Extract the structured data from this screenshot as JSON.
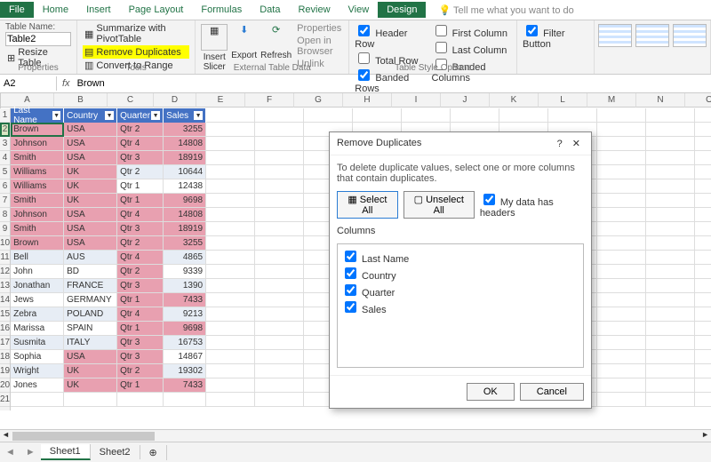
{
  "tabs": {
    "file": "File",
    "home": "Home",
    "insert": "Insert",
    "page_layout": "Page Layout",
    "formulas": "Formulas",
    "data": "Data",
    "review": "Review",
    "view": "View",
    "design": "Design",
    "tellme": "Tell me what you want to do"
  },
  "ribbon": {
    "tableName_label": "Table Name:",
    "tableName_value": "Table2",
    "resize": "Resize Table",
    "properties_group": "Properties",
    "summarize": "Summarize with PivotTable",
    "remove_dup": "Remove Duplicates",
    "convert": "Convert to Range",
    "tools_group": "Tools",
    "insert_slicer": "Insert Slicer",
    "export": "Export",
    "refresh": "Refresh",
    "props": "Properties",
    "open_browser": "Open in Browser",
    "unlink": "Unlink",
    "ext_group": "External Table Data",
    "header_row": "Header Row",
    "total_row": "Total Row",
    "banded_rows": "Banded Rows",
    "first_col": "First Column",
    "last_col": "Last Column",
    "banded_cols": "Banded Columns",
    "filter_btn": "Filter Button",
    "style_group": "Table Style Options"
  },
  "name_box": "A2",
  "fx": "fx",
  "formula": "Brown",
  "columns_letters": [
    "A",
    "B",
    "C",
    "D",
    "E",
    "F",
    "G",
    "H",
    "I",
    "J",
    "K",
    "L",
    "M",
    "N",
    "O"
  ],
  "headers": {
    "c1": "Last Name",
    "c2": "Country",
    "c3": "Quarter",
    "c4": "Sales"
  },
  "rows": [
    {
      "n": 2,
      "c1": "Brown",
      "c2": "USA",
      "c3": "Qtr 2",
      "c4": "3255",
      "dup": [
        1,
        1,
        1,
        1
      ]
    },
    {
      "n": 3,
      "c1": "Johnson",
      "c2": "USA",
      "c3": "Qtr 4",
      "c4": "14808",
      "dup": [
        1,
        1,
        1,
        1
      ]
    },
    {
      "n": 4,
      "c1": "Smith",
      "c2": "USA",
      "c3": "Qtr 3",
      "c4": "18919",
      "dup": [
        1,
        1,
        1,
        1
      ]
    },
    {
      "n": 5,
      "c1": "Williams",
      "c2": "UK",
      "c3": "Qtr 2",
      "c4": "10644",
      "dup": [
        1,
        1,
        0,
        0
      ]
    },
    {
      "n": 6,
      "c1": "Williams",
      "c2": "UK",
      "c3": "Qtr 1",
      "c4": "12438",
      "dup": [
        1,
        1,
        0,
        0
      ]
    },
    {
      "n": 7,
      "c1": "Smith",
      "c2": "UK",
      "c3": "Qtr 1",
      "c4": "9698",
      "dup": [
        1,
        1,
        1,
        1
      ]
    },
    {
      "n": 8,
      "c1": "Johnson",
      "c2": "USA",
      "c3": "Qtr 4",
      "c4": "14808",
      "dup": [
        1,
        1,
        1,
        1
      ]
    },
    {
      "n": 9,
      "c1": "Smith",
      "c2": "USA",
      "c3": "Qtr 3",
      "c4": "18919",
      "dup": [
        1,
        1,
        1,
        1
      ]
    },
    {
      "n": 10,
      "c1": "Brown",
      "c2": "USA",
      "c3": "Qtr 2",
      "c4": "3255",
      "dup": [
        1,
        1,
        1,
        1
      ]
    },
    {
      "n": 11,
      "c1": "Bell",
      "c2": "AUS",
      "c3": "Qtr 4",
      "c4": "4865",
      "dup": [
        0,
        0,
        1,
        0
      ]
    },
    {
      "n": 12,
      "c1": "John",
      "c2": "BD",
      "c3": "Qtr 2",
      "c4": "9339",
      "dup": [
        0,
        0,
        1,
        0
      ]
    },
    {
      "n": 13,
      "c1": "Jonathan",
      "c2": "FRANCE",
      "c3": "Qtr 3",
      "c4": "1390",
      "dup": [
        0,
        0,
        1,
        0
      ]
    },
    {
      "n": 14,
      "c1": "Jews",
      "c2": "GERMANY",
      "c3": "Qtr 1",
      "c4": "7433",
      "dup": [
        0,
        0,
        1,
        1
      ]
    },
    {
      "n": 15,
      "c1": "Zebra",
      "c2": "POLAND",
      "c3": "Qtr 4",
      "c4": "9213",
      "dup": [
        0,
        0,
        1,
        0
      ]
    },
    {
      "n": 16,
      "c1": "Marissa",
      "c2": "SPAIN",
      "c3": "Qtr 1",
      "c4": "9698",
      "dup": [
        0,
        0,
        1,
        1
      ]
    },
    {
      "n": 17,
      "c1": "Susmita",
      "c2": "ITALY",
      "c3": "Qtr 3",
      "c4": "16753",
      "dup": [
        0,
        0,
        1,
        0
      ]
    },
    {
      "n": 18,
      "c1": "Sophia",
      "c2": "USA",
      "c3": "Qtr 3",
      "c4": "14867",
      "dup": [
        0,
        1,
        1,
        0
      ]
    },
    {
      "n": 19,
      "c1": "Wright",
      "c2": "UK",
      "c3": "Qtr 2",
      "c4": "19302",
      "dup": [
        0,
        1,
        1,
        0
      ]
    },
    {
      "n": 20,
      "c1": "Jones",
      "c2": "UK",
      "c3": "Qtr 1",
      "c4": "7433",
      "dup": [
        0,
        1,
        1,
        1
      ]
    }
  ],
  "dialog": {
    "title": "Remove Duplicates",
    "help": "?",
    "close": "✕",
    "text": "To delete duplicate values, select one or more columns that contain duplicates.",
    "select_all": "Select All",
    "unselect_all": "Unselect All",
    "has_headers": "My data has headers",
    "columns_label": "Columns",
    "cols": [
      "Last Name",
      "Country",
      "Quarter",
      "Sales"
    ],
    "ok": "OK",
    "cancel": "Cancel"
  },
  "sheets": {
    "s1": "Sheet1",
    "s2": "Sheet2",
    "add": "⊕"
  },
  "scroll": {
    "left": "◄",
    "right": "►"
  }
}
